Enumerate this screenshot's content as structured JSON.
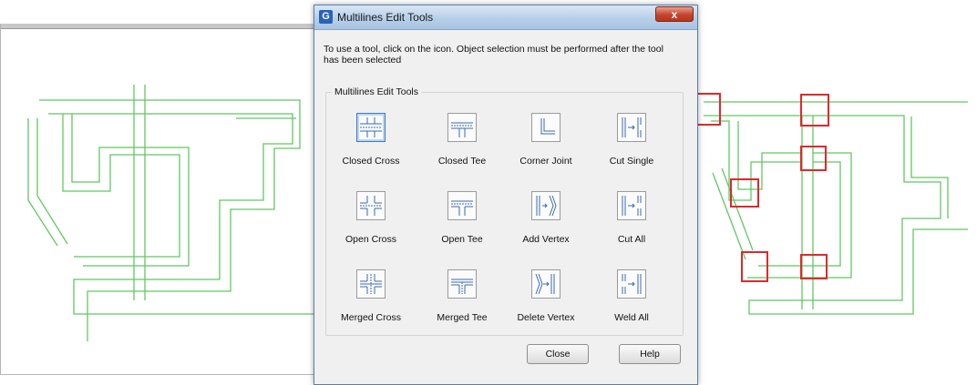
{
  "dialog": {
    "title": "Multilines Edit Tools",
    "app_icon_letter": "G",
    "close_glyph": "x",
    "instructions": "To use a tool, click on the icon. Object selection must be performed after the tool has been selected",
    "group_label": "Multilines Edit Tools",
    "tools": [
      {
        "label": "Closed Cross",
        "icon": "closed-cross-icon",
        "selected": true
      },
      {
        "label": "Closed Tee",
        "icon": "closed-tee-icon"
      },
      {
        "label": "Corner Joint",
        "icon": "corner-joint-icon"
      },
      {
        "label": "Cut Single",
        "icon": "cut-single-icon"
      },
      {
        "label": "Open Cross",
        "icon": "open-cross-icon"
      },
      {
        "label": "Open Tee",
        "icon": "open-tee-icon"
      },
      {
        "label": "Add Vertex",
        "icon": "add-vertex-icon"
      },
      {
        "label": "Cut All",
        "icon": "cut-all-icon"
      },
      {
        "label": "Merged Cross",
        "icon": "merged-cross-icon"
      },
      {
        "label": "Merged Tee",
        "icon": "merged-tee-icon"
      },
      {
        "label": "Delete Vertex",
        "icon": "delete-vertex-icon"
      },
      {
        "label": "Weld All",
        "icon": "weld-all-icon"
      }
    ],
    "buttons": {
      "close": "Close",
      "help": "Help"
    }
  },
  "colors": {
    "multiline": "#62c862",
    "highlight": "#e0282c",
    "titlebar": "#b7cfe9",
    "icon_lines": "#3a6bb0"
  }
}
